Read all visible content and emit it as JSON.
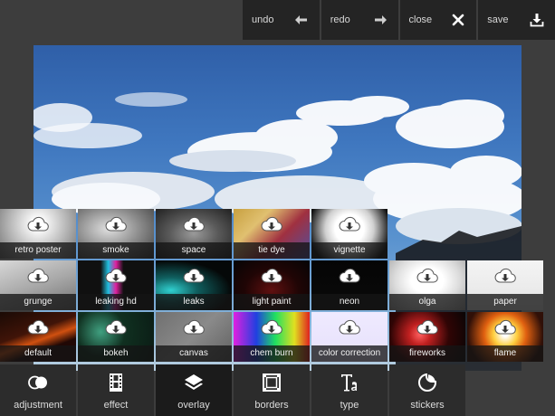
{
  "toolbar": {
    "undo": {
      "label": "undo",
      "icon": "arrow-left-icon"
    },
    "redo": {
      "label": "redo",
      "icon": "arrow-right-icon"
    },
    "close": {
      "label": "close",
      "icon": "close-icon"
    },
    "save": {
      "label": "save",
      "icon": "download-icon"
    }
  },
  "overlays": {
    "row1": [
      {
        "label": "retro poster",
        "bg": "radial-gradient(circle at 50% 30%, #ffffff 10%, #cfcfcf 40%, #6e6e6e 100%)"
      },
      {
        "label": "smoke",
        "bg": "radial-gradient(ellipse at 40% 40%, #e0e0e0 0%, #8a8a8a 50%, #3a3a3a 100%)"
      },
      {
        "label": "space",
        "bg": "radial-gradient(ellipse at 50% 50%, #9a9a9a 0%, #5a5a5a 45%, #202020 100%)"
      },
      {
        "label": "tie dye",
        "bg": "linear-gradient(135deg, #c8a040 0%, #e0c070 30%, #a03040 60%, #5050a0 100%)"
      },
      {
        "label": "vignette",
        "bg": "radial-gradient(circle at 50% 40%, #ffffff 30%, #d0d0d0 50%, #101010 85%)"
      }
    ],
    "row2": [
      {
        "label": "grunge",
        "bg": "linear-gradient(160deg, #d8d8d8 0%, #a8a8a8 50%, #707070 100%)"
      },
      {
        "label": "leaking hd",
        "bg": "linear-gradient(90deg, #101010 0%, #101010 30%, #20c0e0 40%, #e020a0 50%, #101010 60%, #101010 100%)"
      },
      {
        "label": "leaks",
        "bg": "radial-gradient(ellipse at 20% 60%, #30d0d0 0%, #106060 30%, #050808 70%)"
      },
      {
        "label": "light paint",
        "bg": "radial-gradient(ellipse at 50% 60%, #601010 0%, #200505 50%, #050505 100%)"
      },
      {
        "label": "neon",
        "bg": "linear-gradient(180deg, #050505 0%, #0a0a0a 100%)"
      },
      {
        "label": "olga",
        "bg": "radial-gradient(ellipse at 50% 40%, #ffffff 30%, #dcdcdc 60%, #a0a0a0 100%)"
      },
      {
        "label": "paper",
        "bg": "linear-gradient(180deg, #f4f4f4 0%, #e4e4e4 100%)"
      }
    ],
    "row3": [
      {
        "label": "default",
        "bg": "linear-gradient(160deg, #1a0a05 0%, #401408 40%, #d05010 55%, #200805 70%)"
      },
      {
        "label": "bokeh",
        "bg": "radial-gradient(circle at 30% 40%, #40a080 0%, #103020 40%, #0a1a14 100%)"
      },
      {
        "label": "canvas",
        "bg": "linear-gradient(135deg, #707070 0%, #8a8a8a 50%, #606060 100%)"
      },
      {
        "label": "chem burn",
        "bg": "linear-gradient(90deg, #e020e0 0%, #2040e0 30%, #20e060 55%, #e0e020 80%, #e02020 100%)"
      },
      {
        "label": "color correction",
        "bg": "linear-gradient(180deg, #efeaff 0%, #e6e0fb 100%)"
      },
      {
        "label": "fireworks",
        "bg": "radial-gradient(circle at 40% 45%, #ff6060 0%, #c02020 20%, #300505 55%, #050505 100%)"
      },
      {
        "label": "flame",
        "bg": "radial-gradient(circle at 50% 45%, #ffffff 5%, #ffd040 25%, #e06010 45%, #301008 80%)"
      }
    ]
  },
  "bottom_nav": [
    {
      "label": "adjustment",
      "icon": "adjustment-icon",
      "active": false
    },
    {
      "label": "effect",
      "icon": "film-icon",
      "active": false
    },
    {
      "label": "overlay",
      "icon": "layers-icon",
      "active": true
    },
    {
      "label": "borders",
      "icon": "borders-icon",
      "active": false
    },
    {
      "label": "type",
      "icon": "type-icon",
      "active": false
    },
    {
      "label": "stickers",
      "icon": "sticker-icon",
      "active": false
    }
  ],
  "colors": {
    "bg": "#3d3d3d",
    "toolbar": "#242424",
    "nav": "#2c2c2c",
    "nav_active": "#1b1b1b"
  }
}
